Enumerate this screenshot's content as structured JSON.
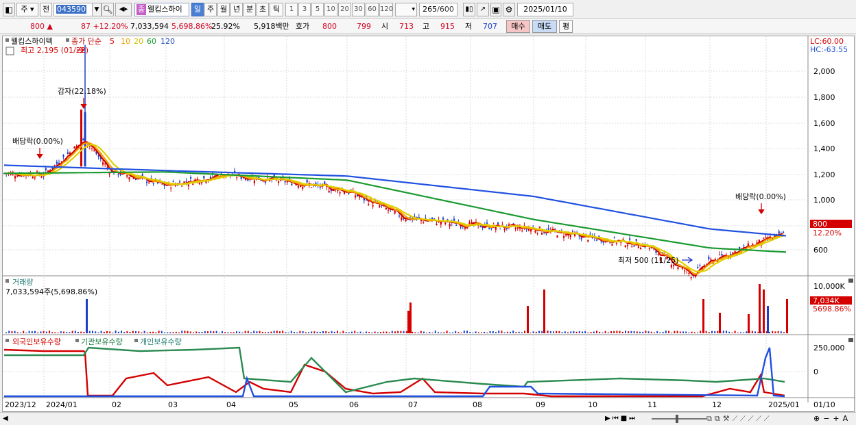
{
  "toolbar": {
    "market": "주",
    "mode": "전",
    "code": "043590",
    "name": "웰킵스하이",
    "name_badge": "종",
    "periods": [
      "일",
      "주",
      "월",
      "년",
      "분",
      "초",
      "틱"
    ],
    "active_period": "일",
    "intervals": [
      "1",
      "3",
      "5",
      "10",
      "20",
      "30",
      "60",
      "120"
    ],
    "count": "265",
    "count_max": "/600",
    "date": "2025/01/10"
  },
  "quote": {
    "price": "800",
    "arrow": "▲",
    "change": "87",
    "change_pct": "+12.20%",
    "volume": "7,033,594",
    "volume_pct": "5,698.86%",
    "turnover": "25.92%",
    "amount": "5,918백만",
    "hoga_label": "호가",
    "ask": "800",
    "bid": "799",
    "open_label": "시",
    "open": "713",
    "high_label": "고",
    "high": "915",
    "low_label": "저",
    "low": "707",
    "buy_label": "매수",
    "sell_label": "매도",
    "eval_label": "평"
  },
  "price_panel": {
    "title": "웰킵스하이텍",
    "legend_label": "종가 단순",
    "ma_periods": [
      "5",
      "10",
      "20",
      "60",
      "120"
    ],
    "ma_colors": [
      "#d40000",
      "#f0a000",
      "#e0d000",
      "#1a9a30",
      "#2050e0"
    ],
    "lc": "LC:60.00",
    "hc": "HC:-63.55",
    "annot_high": "최고 2,195 (01/22)",
    "annot_reduction": "감자(22.18%)",
    "annot_div1": "배당락(0.00%)",
    "annot_div2": "배당락(0.00%)",
    "annot_low": "최저 500 (11/25)",
    "current_price_tag": "800",
    "current_pct_tag": "12.20%",
    "y_ticks": [
      "2,000",
      "1,800",
      "1,600",
      "1,400",
      "1,200",
      "1,000",
      "800",
      "600"
    ]
  },
  "volume_panel": {
    "title": "거래량",
    "subtitle": "7,033,594주(5,698.86%)",
    "y_tick": "10,000K",
    "tag_value": "7,034K",
    "tag_pct": "5698.86%"
  },
  "holdings_panel": {
    "legend": [
      "외국인보유수량",
      "기관보유수량",
      "개인보유수량"
    ],
    "y_ticks": [
      "250,000",
      "0"
    ]
  },
  "x_axis": [
    "2023/12",
    "2024/01",
    "02",
    "03",
    "04",
    "05",
    "06",
    "07",
    "08",
    "09",
    "10",
    "11",
    "12",
    "2025/01",
    "01/10"
  ],
  "chart_data": {
    "type": "line",
    "title": "웰킵스하이텍",
    "series": [
      {
        "name": "종가",
        "x": [
          "2023/12",
          "2024/01",
          "2024/01/22",
          "02",
          "03",
          "04",
          "05",
          "06",
          "07",
          "08",
          "09",
          "10",
          "11",
          "11/25",
          "12",
          "2025/01",
          "01/10"
        ],
        "values": [
          1250,
          1240,
          2195,
          1270,
          1160,
          1240,
          1190,
          1120,
          920,
          870,
          840,
          780,
          720,
          500,
          600,
          760,
          800
        ]
      },
      {
        "name": "120",
        "x": [
          "2023/12",
          "03",
          "06",
          "09",
          "12",
          "01/10"
        ],
        "values": [
          1310,
          1270,
          1230,
          1080,
          840,
          790
        ]
      },
      {
        "name": "60",
        "x": [
          "2023/12",
          "03",
          "06",
          "09",
          "12",
          "01/10"
        ],
        "values": [
          1250,
          1260,
          1200,
          910,
          700,
          670
        ]
      }
    ],
    "ylim": [
      520,
      2250
    ]
  }
}
